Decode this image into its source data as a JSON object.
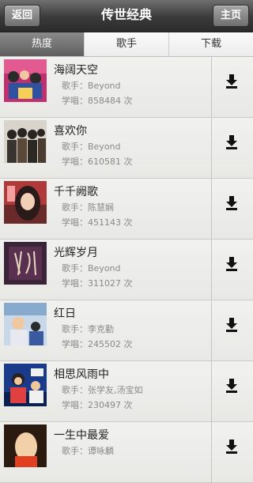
{
  "header": {
    "back_label": "返回",
    "title": "传世经典",
    "home_label": "主页"
  },
  "tabs": [
    {
      "label": "热度",
      "active": true
    },
    {
      "label": "歌手",
      "active": false
    },
    {
      "label": "下载",
      "active": false
    }
  ],
  "songs": [
    {
      "title": "海阔天空",
      "singer_label": "歌手：Beyond",
      "plays_label": "学唱：858484 次"
    },
    {
      "title": "喜欢你",
      "singer_label": "歌手：Beyond",
      "plays_label": "学唱：610581 次"
    },
    {
      "title": "千千阙歌",
      "singer_label": "歌手：陈慧娴",
      "plays_label": "学唱：451143 次"
    },
    {
      "title": "光辉岁月",
      "singer_label": "歌手：Beyond",
      "plays_label": "学唱：311027 次"
    },
    {
      "title": "红日",
      "singer_label": "歌手：李克勤",
      "plays_label": "学唱：245502 次"
    },
    {
      "title": "相思风雨中",
      "singer_label": "歌手：张学友,汤宝如",
      "plays_label": "学唱：230497 次"
    },
    {
      "title": "一生中最爱",
      "singer_label": "歌手：谭咏麟",
      "plays_label": ""
    }
  ],
  "icons": {
    "download": "download-icon",
    "cover": "album-cover"
  },
  "colors": {
    "header_bg": "#3a3a3a",
    "active_tab_bg": "#6a6a6a",
    "text_primary": "#222222",
    "text_secondary": "#8a8a8a"
  }
}
